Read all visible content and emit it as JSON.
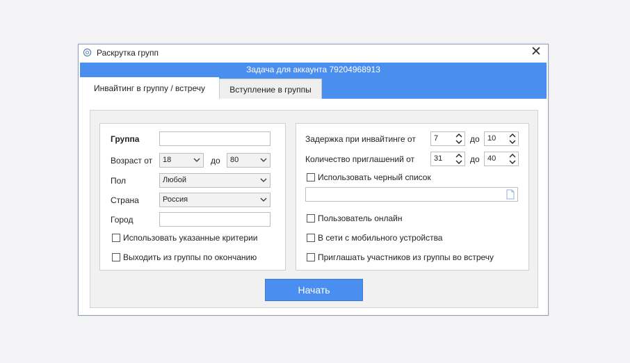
{
  "window": {
    "title": "Раскрутка групп",
    "icon": "gear-icon",
    "close_icon": "close-icon"
  },
  "banner": {
    "text": "Задача для аккаунта 79204968913",
    "color": "#4a8ef0"
  },
  "tabs": [
    {
      "label": "Инвайтинг в группу / встречу",
      "active": true
    },
    {
      "label": "Вступление в группы",
      "active": false
    }
  ],
  "left": {
    "group_label": "Группа",
    "group_value": "",
    "age_label": "Возраст от",
    "age_from": "18",
    "age_to_label": "до",
    "age_to": "80",
    "sex_label": "Пол",
    "sex_value": "Любой",
    "country_label": "Страна",
    "country_value": "Россия",
    "city_label": "Город",
    "city_value": "",
    "use_criteria": "Использовать указанные критерии",
    "leave_group": "Выходить из группы по окончанию"
  },
  "right": {
    "delay_label": "Задержка при инвайтинге от",
    "delay_from": "7",
    "delay_to_label": "до",
    "delay_to": "10",
    "invites_label": "Количество приглашений от",
    "invites_from": "31",
    "invites_to_label": "до",
    "invites_to": "40",
    "use_blacklist": "Использовать черный список",
    "blacklist_path": "",
    "user_online": "Пользователь онлайн",
    "mobile": "В сети с мобильного устройства",
    "invite_members": "Приглашать участников из группы во встречу"
  },
  "start_button": "Начать",
  "accent_color": "#4a8ef0"
}
